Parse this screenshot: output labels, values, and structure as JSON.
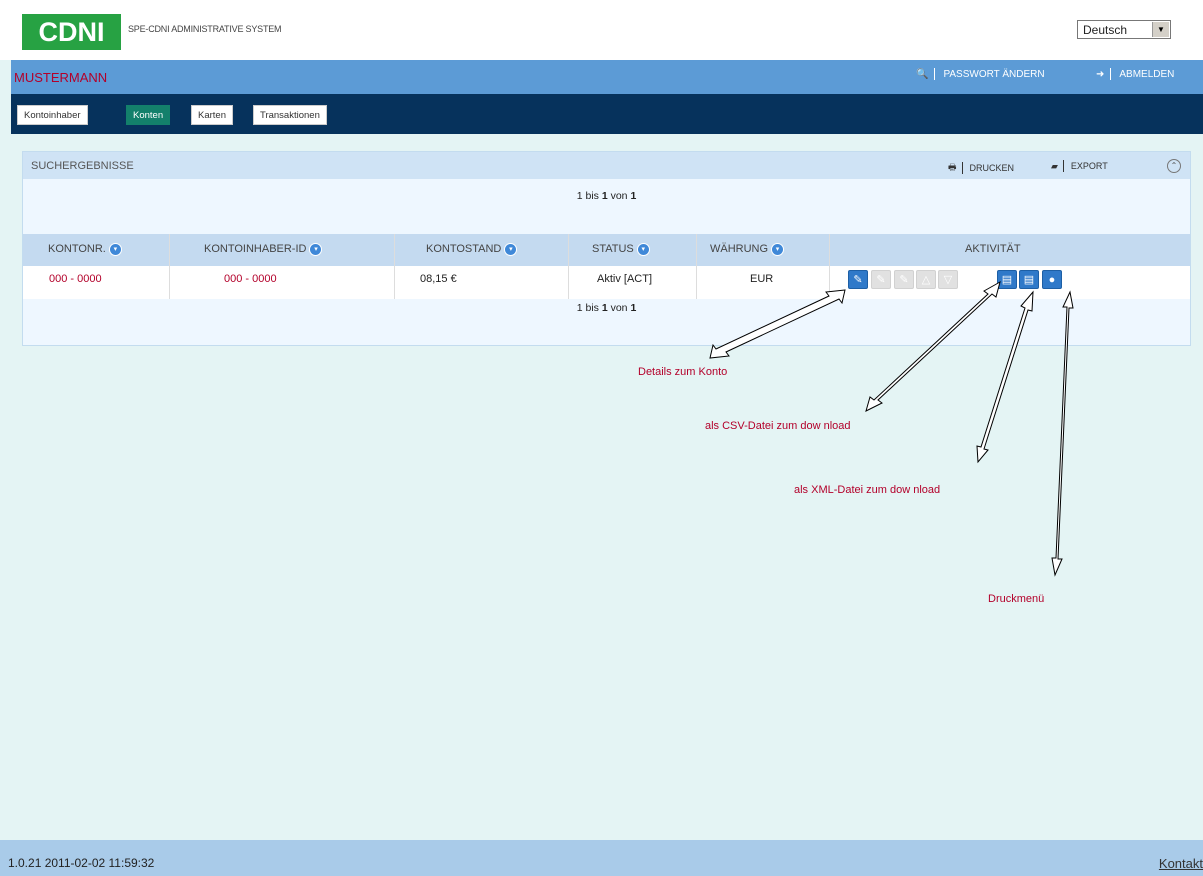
{
  "header": {
    "logo_text": "CDNI",
    "app_title": "SPE-CDNI ADMINISTRATIVE SYSTEM",
    "language": {
      "selected": "Deutsch"
    }
  },
  "userbar": {
    "username": "MUSTERMANN",
    "change_password_label": "PASSWORT ÄNDERN",
    "logout_label": "ABMELDEN"
  },
  "nav": {
    "tabs": [
      {
        "label": "Kontoinhaber",
        "active": false
      },
      {
        "label": "Konten",
        "active": true
      },
      {
        "label": "Karten",
        "active": false
      },
      {
        "label": "Transaktionen",
        "active": false
      }
    ]
  },
  "results": {
    "title": "SUCHERGEBNISSE",
    "print_label": "DRUCKEN",
    "export_label": "EXPORT",
    "pager": {
      "prefix": "1 bis ",
      "from": "1",
      "middle": " von ",
      "total": "1"
    },
    "columns": [
      "KONTONR.",
      "KONTOINHABER-ID",
      "KONTOSTAND",
      "STATUS",
      "WÄHRUNG",
      "AKTIVITÄT"
    ],
    "rows": [
      {
        "kontonr": "000 - 0000",
        "kontoinhaber_id": "000 - 0000",
        "kontostand": "08,15 €",
        "status": "Aktiv [ACT]",
        "waehrung": "EUR"
      }
    ],
    "actions": [
      {
        "name": "details-icon",
        "enabled": true
      },
      {
        "name": "edit-icon",
        "enabled": false
      },
      {
        "name": "edit-note-icon",
        "enabled": false
      },
      {
        "name": "warning-icon",
        "enabled": false
      },
      {
        "name": "filter-icon",
        "enabled": false
      },
      {
        "name": "csv-download-icon",
        "enabled": true
      },
      {
        "name": "xml-download-icon",
        "enabled": true
      },
      {
        "name": "print-menu-icon",
        "enabled": true
      }
    ]
  },
  "annotations": {
    "details": "Details zum Konto",
    "csv": "als CSV-Datei zum dow nload",
    "xml": "als XML-Datei zum dow nload",
    "print": "Druckmenü"
  },
  "footer": {
    "version": "1.0.21 2011-02-02 11:59:32",
    "contact": "Kontakt"
  },
  "colors": {
    "brand_green": "#27a243",
    "userbar_blue": "#5c9bd6",
    "nav_navy": "#06325c",
    "active_tab": "#13806b",
    "accent_red": "#b3002a"
  }
}
